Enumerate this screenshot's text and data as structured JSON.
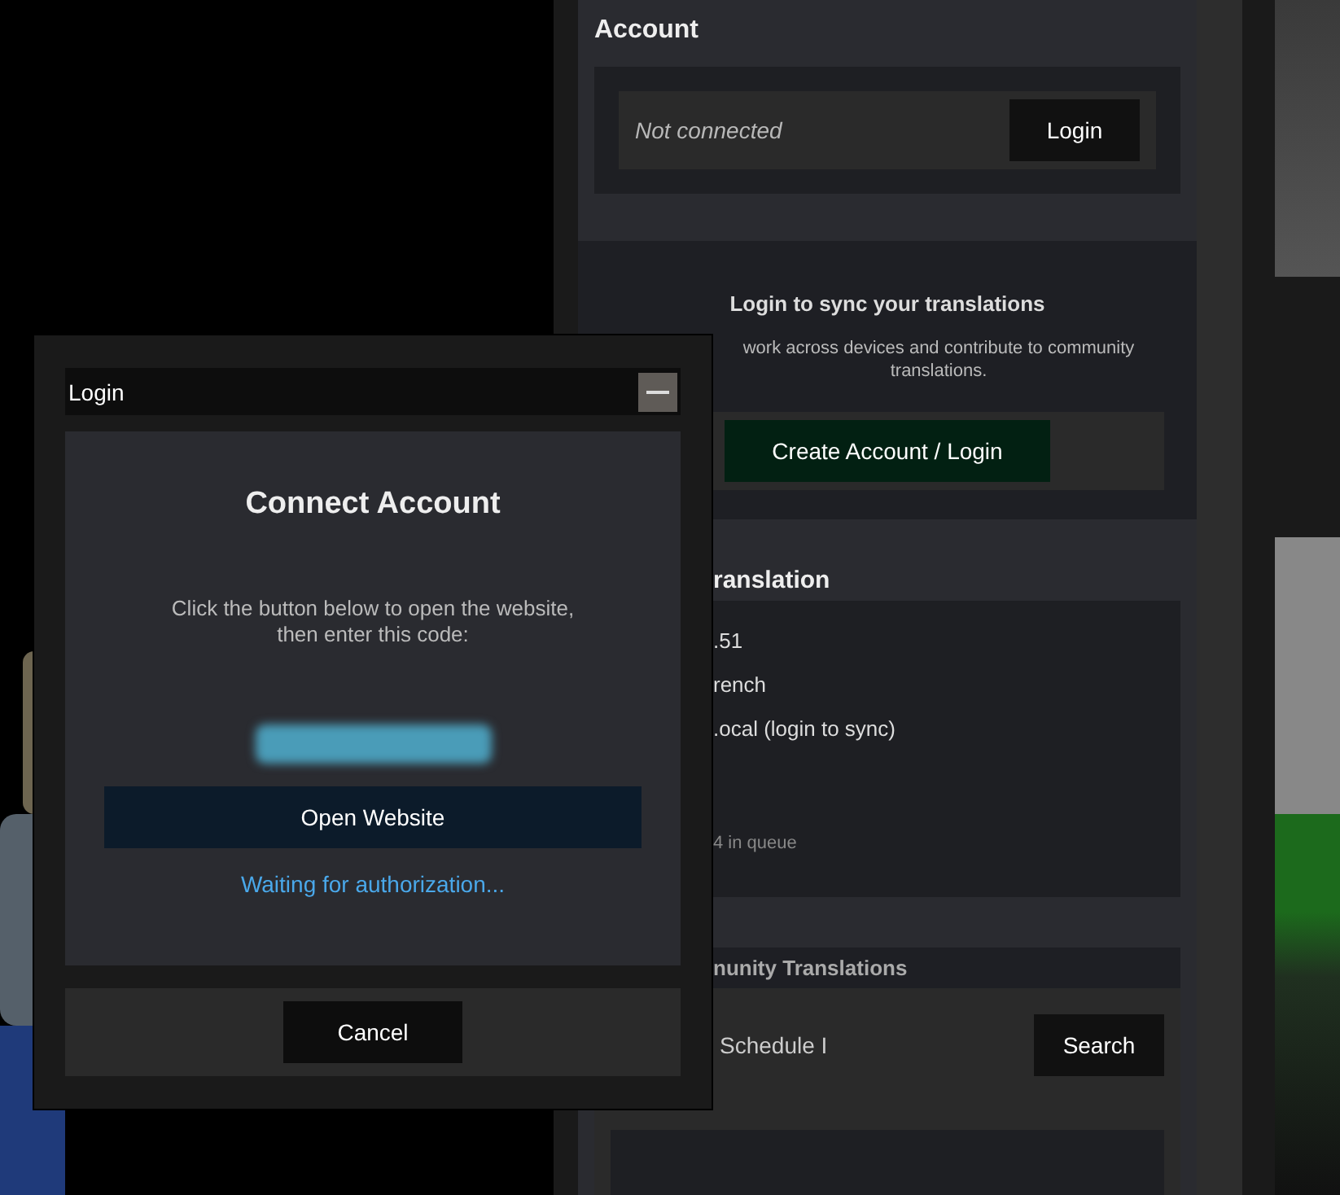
{
  "account": {
    "title": "Account",
    "status": "Not connected",
    "login_button": "Login"
  },
  "sync_prompt": {
    "title": "Login to sync your translations",
    "description_lines": [
      "work across devices and contribute to community",
      "translations."
    ],
    "button": "Create Account / Login"
  },
  "translation": {
    "title": "ranslation",
    "rows": [
      ".51",
      "rench",
      ".ocal (login to sync)"
    ],
    "queue": "4 in queue"
  },
  "community": {
    "title": "nunity Translations",
    "search_value": "Schedule I",
    "search_button": "Search"
  },
  "login_dialog": {
    "title": "Login",
    "heading": "Connect Account",
    "instruction_lines": [
      "Click the button below to open the website,",
      "then enter this code:"
    ],
    "open_button": "Open Website",
    "status": "Waiting for authorization...",
    "cancel_button": "Cancel"
  }
}
